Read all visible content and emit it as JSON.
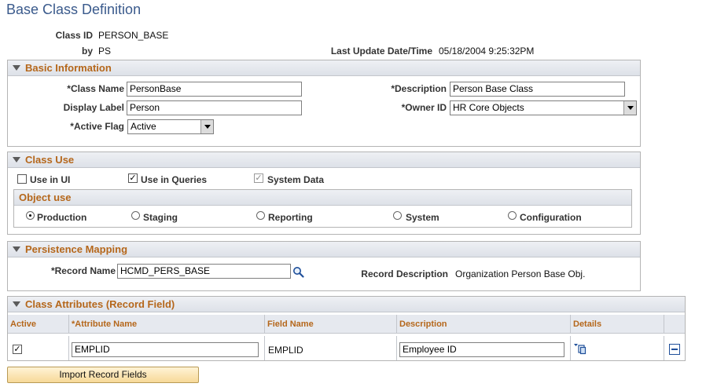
{
  "page": {
    "title": "Base Class Definition"
  },
  "header": {
    "class_id_label": "Class ID",
    "class_id_value": "PERSON_BASE",
    "by_label": "by",
    "by_value": "PS",
    "last_update_label": "Last Update Date/Time",
    "last_update_value": "05/18/2004  9:25:32PM"
  },
  "basic": {
    "title": "Basic Information",
    "class_name_label": "*Class Name",
    "class_name_value": "PersonBase",
    "description_label": "*Description",
    "description_value": "Person Base Class",
    "display_label_label": "Display Label",
    "display_label_value": "Person",
    "owner_id_label": "*Owner ID",
    "owner_id_value": "HR Core Objects",
    "active_flag_label": "*Active Flag",
    "active_flag_value": "Active"
  },
  "class_use": {
    "title": "Class Use",
    "use_in_ui_label": "Use in UI",
    "use_in_ui_checked": false,
    "use_in_queries_label": "Use in Queries",
    "use_in_queries_checked": true,
    "system_data_label": "System Data",
    "system_data_checked": true,
    "object_use": {
      "title": "Object use",
      "options": [
        "Production",
        "Staging",
        "Reporting",
        "System",
        "Configuration"
      ],
      "selected": "Production"
    }
  },
  "persistence": {
    "title": "Persistence Mapping",
    "record_name_label": "*Record Name",
    "record_name_value": "HCMD_PERS_BASE",
    "record_desc_label": "Record Description",
    "record_desc_value": "Organization Person Base Obj."
  },
  "attributes": {
    "title": "Class Attributes (Record Field)",
    "columns": [
      "Active",
      "*Attribute Name",
      "Field Name",
      "Description",
      "Details"
    ],
    "rows": [
      {
        "active": true,
        "attribute_name": "EMPLID",
        "field_name": "EMPLID",
        "description": "Employee ID"
      }
    ]
  },
  "buttons": {
    "import": "Import Record Fields"
  },
  "icons": {
    "lookup": "magnifier-icon",
    "details": "details-icon",
    "delete_row": "minus-icon",
    "collapse": "triangle-down-icon"
  }
}
